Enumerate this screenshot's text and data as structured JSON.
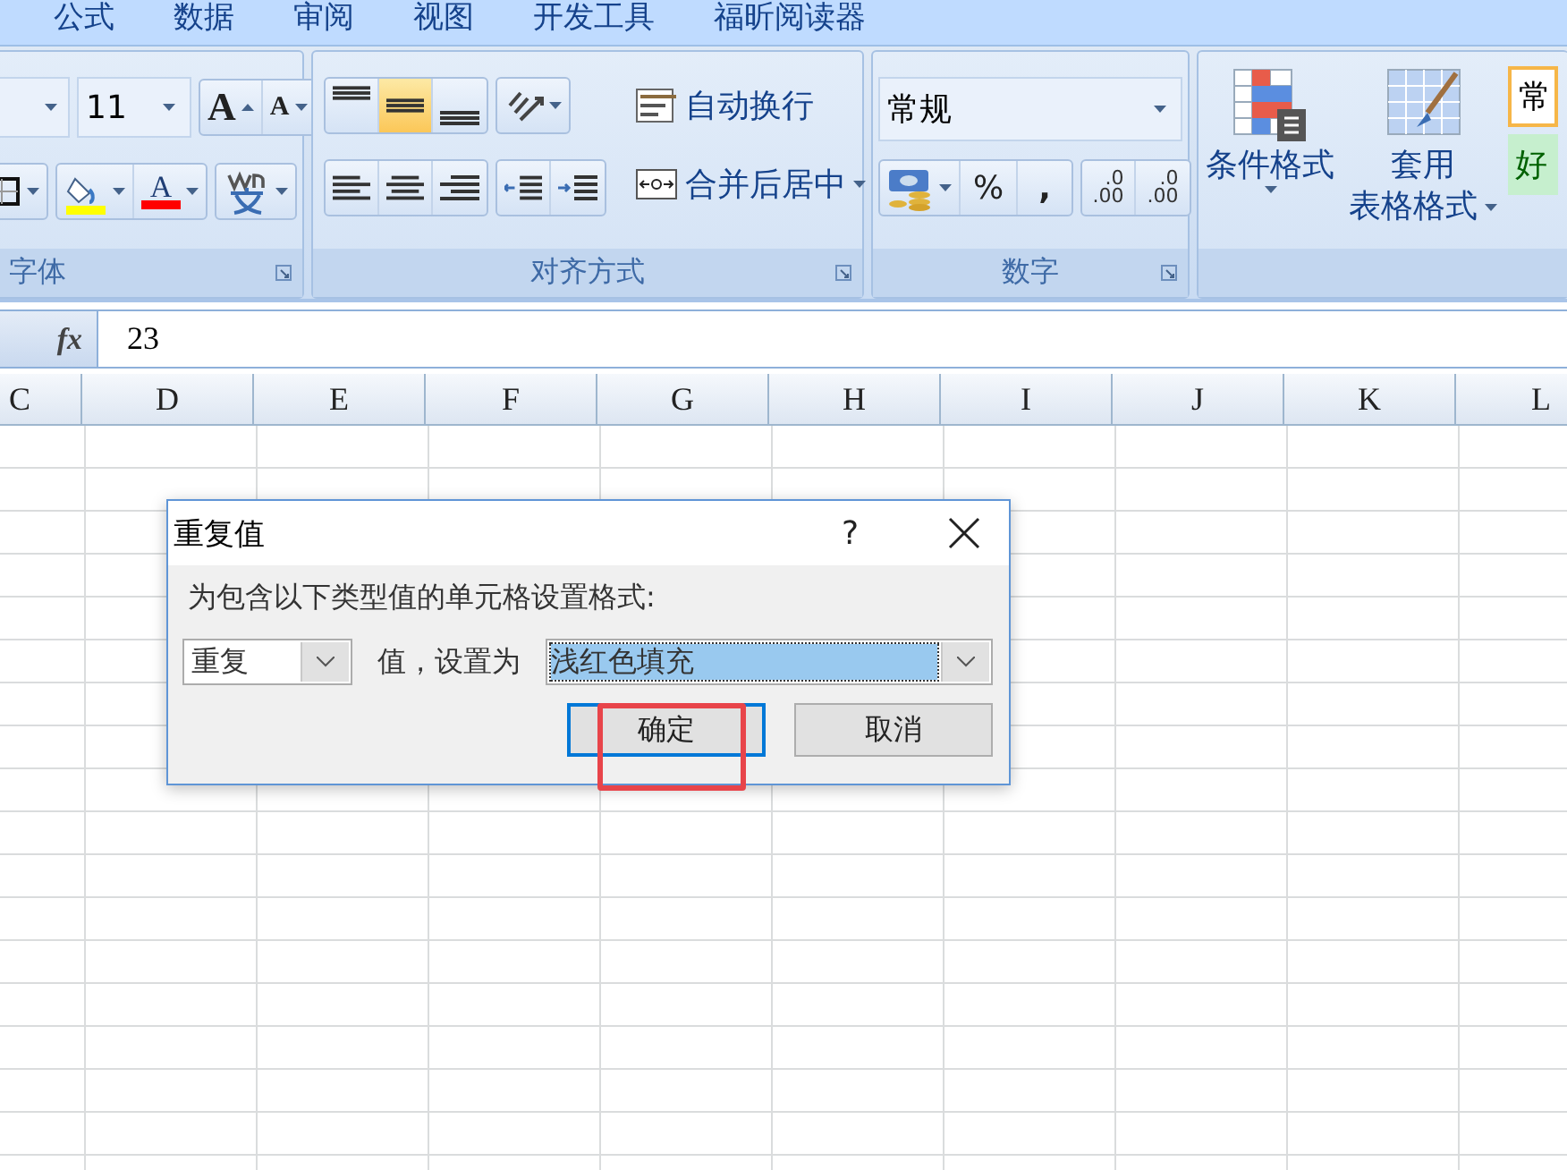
{
  "menu_tabs": [
    "公式",
    "数据",
    "审阅",
    "视图",
    "开发工具",
    "福昕阅读器"
  ],
  "font_group": {
    "size": "11",
    "grow_font": "A",
    "shrink_font": "A",
    "font_color_label": "A",
    "label": "字体"
  },
  "alignment_group": {
    "vertical_align": [
      {
        "selected": false
      },
      {
        "selected": true
      },
      {
        "selected": false
      }
    ],
    "wrap_text": "自动换行",
    "merge_center": "合并后居中",
    "label": "对齐方式"
  },
  "number_group": {
    "format": "常规",
    "percent": "%",
    "comma": ",",
    "decimal_buttons": [
      {
        "top": ".0",
        "bottom": ".00"
      },
      {
        "top": ".0",
        "bottom": ".00"
      }
    ],
    "label": "数字"
  },
  "styles_group": {
    "conditional_format": "条件格式",
    "table_format": [
      "套用",
      "表格格式"
    ],
    "style_cells": [
      "常",
      "好"
    ]
  },
  "formula_bar": {
    "fx": "fx",
    "value": "23"
  },
  "columns": [
    "C",
    "D",
    "E",
    "F",
    "G",
    "H",
    "I",
    "J",
    "K",
    "L"
  ],
  "dialog": {
    "title": "重复值",
    "help": "?",
    "prompt": "为包含以下类型值的单元格设置格式:",
    "rule_select": "重复",
    "middle_label": "值，设置为",
    "format_select": "浅红色填充",
    "ok": "确定",
    "cancel": "取消"
  }
}
